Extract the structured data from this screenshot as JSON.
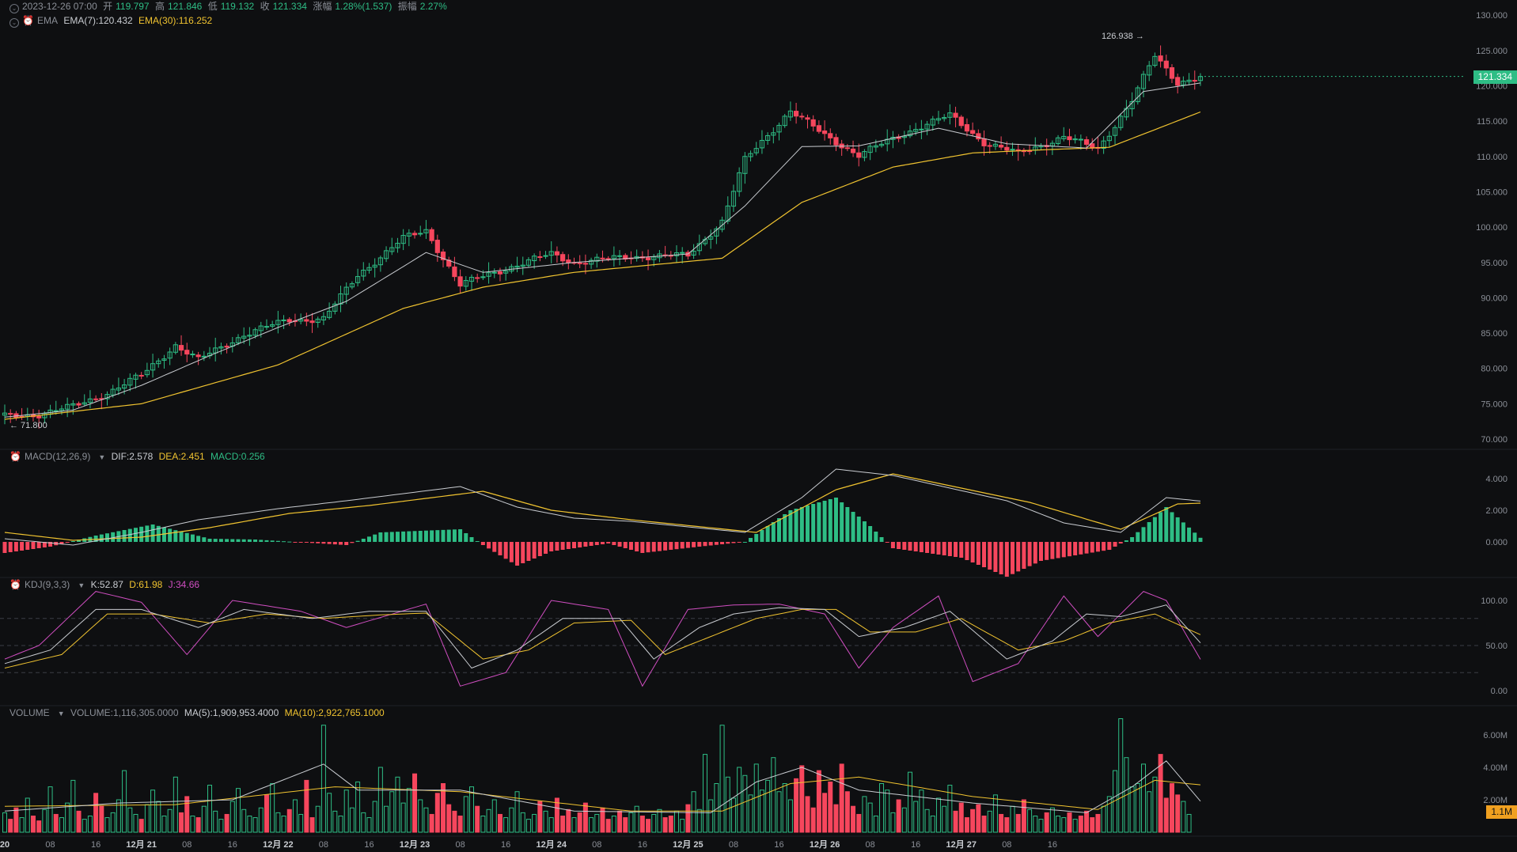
{
  "header": {
    "date": "2023-12-26 07:00",
    "open_label": "开",
    "open": "119.797",
    "high_label": "高",
    "high": "121.846",
    "low_label": "低",
    "low": "119.132",
    "close_label": "收",
    "close": "121.334",
    "change_label": "涨幅",
    "change": "1.28%(1.537)",
    "amp_label": "振幅",
    "amp": "2.27%"
  },
  "ema_legend": {
    "name": "EMA",
    "ema7": "EMA(7):120.432",
    "ema30": "EMA(30):116.252"
  },
  "macd_legend": {
    "name": "MACD(12,26,9)",
    "dif": "DIF:2.578",
    "dea": "DEA:2.451",
    "macd": "MACD:0.256"
  },
  "kdj_legend": {
    "name": "KDJ(9,3,3)",
    "k": "K:52.87",
    "d": "D:61.98",
    "j": "J:34.66"
  },
  "vol_legend": {
    "name": "VOLUME",
    "vol": "VOLUME:1,116,305.0000",
    "ma5": "MA(5):1,909,953.4000",
    "ma10": "MA(10):2,922,765.1000"
  },
  "price_tag": "121.334",
  "volume_tag": "1.1M",
  "max_marker": "126.938 →",
  "min_marker": "← 71.800",
  "colors": {
    "up": "#2ebd85",
    "down": "#f6465d",
    "ema7": "#c9ccd1",
    "ema30": "#f0c330",
    "j": "#d04ec1",
    "bg": "#0e0f11",
    "tag_vol": "#f0a020"
  },
  "chart_data": {
    "type": "candlestick",
    "interval": "1h",
    "price_axis": {
      "ticks": [
        "130.000",
        "125.000",
        "120.000",
        "115.000",
        "110.000",
        "105.000",
        "100.000",
        "95.000",
        "90.000",
        "85.000",
        "80.000",
        "75.000",
        "70.000"
      ],
      "ylim": [
        70,
        130
      ]
    },
    "macd_axis": {
      "ticks": [
        "4.000",
        "2.000",
        "0.000"
      ]
    },
    "kdj_axis": {
      "ticks": [
        "100.00",
        "50.00",
        "0.00"
      ]
    },
    "volume_axis": {
      "ticks": [
        "6.00M",
        "4.00M",
        "2.00M"
      ]
    },
    "time_axis": [
      {
        "label": "20",
        "bold": true
      },
      {
        "label": "08",
        "bold": false
      },
      {
        "label": "16",
        "bold": false
      },
      {
        "label": "12月 21",
        "bold": true
      },
      {
        "label": "08",
        "bold": false
      },
      {
        "label": "16",
        "bold": false
      },
      {
        "label": "12月 22",
        "bold": true
      },
      {
        "label": "08",
        "bold": false
      },
      {
        "label": "16",
        "bold": false
      },
      {
        "label": "12月 23",
        "bold": true
      },
      {
        "label": "08",
        "bold": false
      },
      {
        "label": "16",
        "bold": false
      },
      {
        "label": "12月 24",
        "bold": true
      },
      {
        "label": "08",
        "bold": false
      },
      {
        "label": "16",
        "bold": false
      },
      {
        "label": "12月 25",
        "bold": true
      },
      {
        "label": "08",
        "bold": false
      },
      {
        "label": "16",
        "bold": false
      },
      {
        "label": "12月 26",
        "bold": true
      },
      {
        "label": "08",
        "bold": false
      },
      {
        "label": "16",
        "bold": false
      },
      {
        "label": "12月 27",
        "bold": true
      },
      {
        "label": "08",
        "bold": false
      },
      {
        "label": "16",
        "bold": false
      }
    ],
    "price_keys": [
      [
        0,
        73.2
      ],
      [
        6,
        73.5
      ],
      [
        12,
        74.6
      ],
      [
        18,
        76.5
      ],
      [
        24,
        79.0
      ],
      [
        30,
        83.3
      ],
      [
        34,
        81.2
      ],
      [
        42,
        84.8
      ],
      [
        50,
        86.9
      ],
      [
        56,
        87.0
      ],
      [
        62,
        93.2
      ],
      [
        70,
        98.4
      ],
      [
        74,
        99.5
      ],
      [
        80,
        91.8
      ],
      [
        86,
        93.6
      ],
      [
        96,
        96.2
      ],
      [
        100,
        95.0
      ],
      [
        110,
        95.8
      ],
      [
        120,
        96.0
      ],
      [
        126,
        100.8
      ],
      [
        130,
        109.5
      ],
      [
        138,
        116.5
      ],
      [
        144,
        113.0
      ],
      [
        150,
        110.2
      ],
      [
        160,
        114.0
      ],
      [
        166,
        115.8
      ],
      [
        172,
        112.0
      ],
      [
        178,
        110.4
      ],
      [
        186,
        112.8
      ],
      [
        192,
        111.0
      ],
      [
        198,
        118.0
      ],
      [
        202,
        124.2
      ],
      [
        206,
        120.5
      ],
      [
        210,
        121.3
      ]
    ],
    "ema7_keys": [
      [
        0,
        73.1
      ],
      [
        12,
        74.1
      ],
      [
        24,
        77.6
      ],
      [
        36,
        81.8
      ],
      [
        48,
        85.8
      ],
      [
        60,
        89.5
      ],
      [
        74,
        96.4
      ],
      [
        84,
        93.6
      ],
      [
        100,
        95.0
      ],
      [
        120,
        96.2
      ],
      [
        130,
        103.0
      ],
      [
        140,
        111.4
      ],
      [
        150,
        111.5
      ],
      [
        164,
        114.0
      ],
      [
        176,
        111.8
      ],
      [
        190,
        111.2
      ],
      [
        200,
        119.2
      ],
      [
        210,
        120.4
      ]
    ],
    "ema30_keys": [
      [
        0,
        72.8
      ],
      [
        24,
        75.0
      ],
      [
        48,
        80.5
      ],
      [
        70,
        88.5
      ],
      [
        84,
        91.5
      ],
      [
        100,
        93.6
      ],
      [
        126,
        95.6
      ],
      [
        140,
        103.5
      ],
      [
        156,
        108.5
      ],
      [
        170,
        110.5
      ],
      [
        184,
        111.0
      ],
      [
        194,
        111.3
      ],
      [
        210,
        116.3
      ]
    ],
    "dif_keys": [
      [
        0,
        0.2
      ],
      [
        12,
        -0.2
      ],
      [
        24,
        0.6
      ],
      [
        34,
        1.4
      ],
      [
        48,
        2.1
      ],
      [
        60,
        2.6
      ],
      [
        80,
        3.5
      ],
      [
        90,
        2.2
      ],
      [
        100,
        1.5
      ],
      [
        110,
        1.3
      ],
      [
        130,
        0.6
      ],
      [
        140,
        2.8
      ],
      [
        146,
        4.6
      ],
      [
        156,
        4.2
      ],
      [
        166,
        3.4
      ],
      [
        176,
        2.6
      ],
      [
        186,
        1.2
      ],
      [
        196,
        0.6
      ],
      [
        204,
        2.8
      ],
      [
        210,
        2.58
      ]
    ],
    "dea_keys": [
      [
        0,
        0.6
      ],
      [
        12,
        0.1
      ],
      [
        24,
        0.3
      ],
      [
        36,
        0.9
      ],
      [
        50,
        1.8
      ],
      [
        64,
        2.3
      ],
      [
        84,
        3.2
      ],
      [
        96,
        2.0
      ],
      [
        110,
        1.4
      ],
      [
        132,
        0.6
      ],
      [
        146,
        3.3
      ],
      [
        156,
        4.3
      ],
      [
        168,
        3.4
      ],
      [
        180,
        2.5
      ],
      [
        196,
        0.8
      ],
      [
        206,
        2.4
      ],
      [
        210,
        2.45
      ]
    ],
    "hist_keys": [
      [
        0,
        -0.7
      ],
      [
        8,
        -0.3
      ],
      [
        16,
        0.4
      ],
      [
        26,
        1.1
      ],
      [
        36,
        0.2
      ],
      [
        44,
        0.15
      ],
      [
        60,
        -0.2
      ],
      [
        66,
        0.6
      ],
      [
        80,
        0.8
      ],
      [
        84,
        -0.2
      ],
      [
        90,
        -1.5
      ],
      [
        96,
        -0.6
      ],
      [
        106,
        -0.1
      ],
      [
        112,
        -0.7
      ],
      [
        122,
        -0.3
      ],
      [
        130,
        0.0
      ],
      [
        138,
        2.0
      ],
      [
        146,
        2.8
      ],
      [
        152,
        1.0
      ],
      [
        156,
        -0.4
      ],
      [
        168,
        -1.0
      ],
      [
        176,
        -2.2
      ],
      [
        182,
        -1.2
      ],
      [
        194,
        -0.5
      ],
      [
        198,
        0.3
      ],
      [
        204,
        2.2
      ],
      [
        210,
        0.26
      ]
    ],
    "k_keys": [
      [
        0,
        30
      ],
      [
        8,
        45
      ],
      [
        16,
        90
      ],
      [
        24,
        90
      ],
      [
        34,
        70
      ],
      [
        42,
        90
      ],
      [
        54,
        80
      ],
      [
        64,
        88
      ],
      [
        74,
        88
      ],
      [
        82,
        25
      ],
      [
        90,
        45
      ],
      [
        98,
        80
      ],
      [
        108,
        80
      ],
      [
        114,
        35
      ],
      [
        122,
        70
      ],
      [
        128,
        85
      ],
      [
        136,
        92
      ],
      [
        144,
        90
      ],
      [
        150,
        60
      ],
      [
        158,
        70
      ],
      [
        166,
        88
      ],
      [
        176,
        35
      ],
      [
        184,
        55
      ],
      [
        190,
        85
      ],
      [
        196,
        82
      ],
      [
        204,
        95
      ],
      [
        210,
        52.87
      ]
    ],
    "d_keys": [
      [
        0,
        25
      ],
      [
        10,
        40
      ],
      [
        18,
        85
      ],
      [
        26,
        85
      ],
      [
        36,
        75
      ],
      [
        46,
        85
      ],
      [
        56,
        80
      ],
      [
        66,
        84
      ],
      [
        74,
        86
      ],
      [
        84,
        35
      ],
      [
        92,
        45
      ],
      [
        100,
        75
      ],
      [
        110,
        78
      ],
      [
        116,
        40
      ],
      [
        124,
        60
      ],
      [
        132,
        80
      ],
      [
        140,
        90
      ],
      [
        146,
        90
      ],
      [
        152,
        65
      ],
      [
        160,
        65
      ],
      [
        168,
        80
      ],
      [
        178,
        45
      ],
      [
        186,
        55
      ],
      [
        194,
        75
      ],
      [
        202,
        85
      ],
      [
        210,
        61.98
      ]
    ],
    "j_keys": [
      [
        0,
        35
      ],
      [
        6,
        50
      ],
      [
        16,
        110
      ],
      [
        24,
        98
      ],
      [
        32,
        40
      ],
      [
        40,
        100
      ],
      [
        52,
        88
      ],
      [
        60,
        70
      ],
      [
        74,
        96
      ],
      [
        80,
        5
      ],
      [
        88,
        20
      ],
      [
        96,
        100
      ],
      [
        106,
        90
      ],
      [
        112,
        5
      ],
      [
        120,
        90
      ],
      [
        128,
        95
      ],
      [
        136,
        96
      ],
      [
        144,
        85
      ],
      [
        150,
        25
      ],
      [
        156,
        70
      ],
      [
        164,
        105
      ],
      [
        170,
        10
      ],
      [
        178,
        30
      ],
      [
        186,
        105
      ],
      [
        192,
        60
      ],
      [
        200,
        110
      ],
      [
        204,
        100
      ],
      [
        210,
        34.66
      ]
    ],
    "volume_levels": [
      1.2,
      0.8,
      1.5,
      0.9,
      2.1,
      1.0,
      0.7,
      1.4,
      2.8,
      1.1,
      0.9,
      1.8,
      3.2,
      1.3,
      0.8,
      1.0,
      2.4,
      1.6,
      0.9,
      1.2,
      2.0,
      3.8,
      1.5,
      1.1,
      0.8,
      1.7,
      2.6,
      1.9,
      1.0,
      1.4,
      3.4,
      1.2,
      2.2,
      1.0,
      0.9,
      1.6,
      2.9,
      1.3,
      0.8,
      1.1,
      1.9,
      2.7,
      1.4,
      1.0,
      0.9,
      1.5,
      2.3,
      3.0,
      1.2,
      1.0,
      1.4,
      2.0,
      1.1,
      3.2,
      0.9,
      1.6,
      6.6,
      2.4,
      1.3,
      1.0,
      2.6,
      1.5,
      3.1,
      1.2,
      0.9,
      1.9,
      4.0,
      1.6,
      2.5,
      3.4,
      1.8,
      2.7,
      3.6,
      2.0,
      1.5,
      1.1,
      2.4,
      3.0,
      1.7,
      1.3,
      1.0,
      2.2,
      2.8,
      1.6,
      1.0,
      1.4,
      2.0,
      1.1,
      0.9,
      1.5,
      2.5,
      1.2,
      0.8,
      1.1,
      1.9,
      1.3,
      0.9,
      2.1,
      1.0,
      1.4,
      0.9,
      1.2,
      1.8,
      0.9,
      1.1,
      1.5,
      0.8,
      1.0,
      1.3,
      0.9,
      1.2,
      1.6,
      1.0,
      0.8,
      1.1,
      1.4,
      0.9,
      1.0,
      1.3,
      0.8,
      1.7,
      2.5,
      1.4,
      4.8,
      2.0,
      3.0,
      6.6,
      3.4,
      2.1,
      4.0,
      3.5,
      2.3,
      4.2,
      2.6,
      3.2,
      4.6,
      2.5,
      3.0,
      2.0,
      3.3,
      4.1,
      2.2,
      1.5,
      3.8,
      2.4,
      3.1,
      1.7,
      4.2,
      2.5,
      1.6,
      1.1,
      2.2,
      1.8,
      1.0,
      3.0,
      2.6,
      1.2,
      2.0,
      1.5,
      3.7,
      1.9,
      2.6,
      1.4,
      1.0,
      2.1,
      1.6,
      2.9,
      1.3,
      1.8,
      0.9,
      1.4,
      1.7,
      1.0,
      1.3,
      2.3,
      1.1,
      0.9,
      1.6,
      1.1,
      2.0,
      1.4,
      1.0,
      0.8,
      1.2,
      1.5,
      1.0,
      0.9,
      1.2,
      0.8,
      1.0,
      1.3,
      0.9,
      1.1,
      1.6,
      2.2,
      3.8,
      7.0,
      4.6,
      2.8,
      3.0,
      4.2,
      2.5,
      3.4,
      4.8,
      2.1,
      3.0,
      2.3,
      1.9,
      1.1
    ],
    "volume_ma5_keys": [
      [
        0,
        1.3
      ],
      [
        20,
        1.8
      ],
      [
        40,
        2.0
      ],
      [
        56,
        4.2
      ],
      [
        62,
        2.6
      ],
      [
        80,
        2.6
      ],
      [
        100,
        1.3
      ],
      [
        124,
        1.2
      ],
      [
        132,
        3.1
      ],
      [
        140,
        4.0
      ],
      [
        150,
        2.6
      ],
      [
        170,
        1.8
      ],
      [
        190,
        1.2
      ],
      [
        198,
        2.8
      ],
      [
        204,
        4.4
      ],
      [
        210,
        1.91
      ]
    ],
    "volume_ma10_keys": [
      [
        0,
        1.6
      ],
      [
        30,
        1.7
      ],
      [
        58,
        2.8
      ],
      [
        80,
        2.5
      ],
      [
        110,
        1.3
      ],
      [
        126,
        1.3
      ],
      [
        138,
        3.0
      ],
      [
        150,
        3.4
      ],
      [
        170,
        2.2
      ],
      [
        192,
        1.4
      ],
      [
        202,
        3.2
      ],
      [
        210,
        2.92
      ]
    ]
  }
}
